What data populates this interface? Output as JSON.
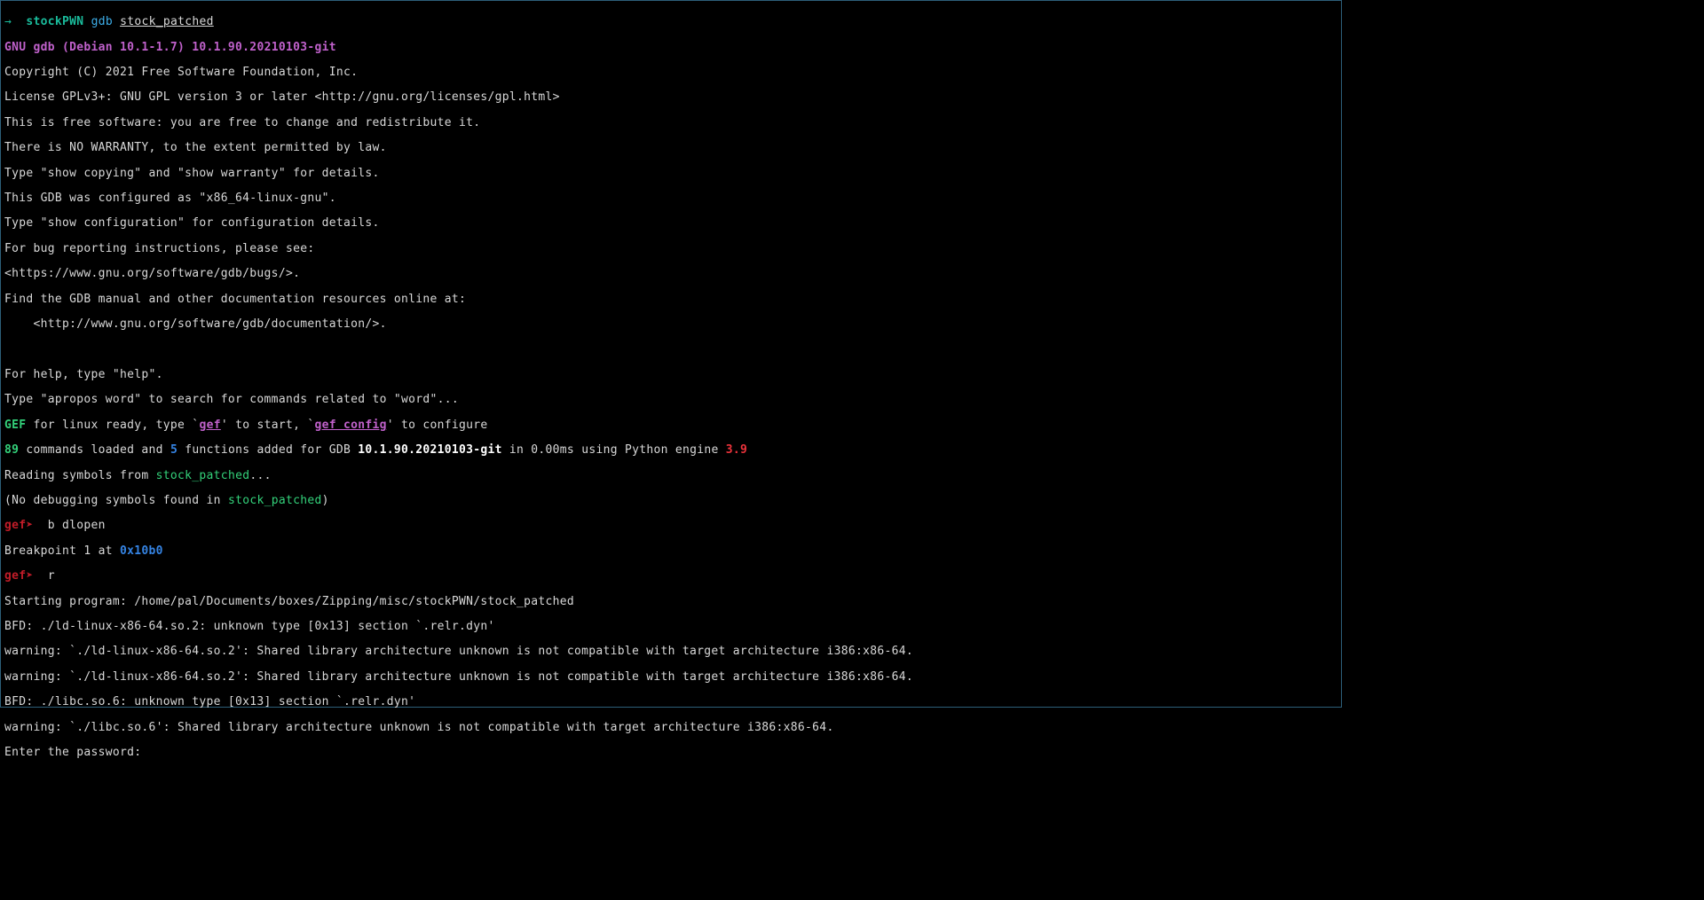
{
  "prompt_line": {
    "arrow": "→",
    "cwd": "stockPWN",
    "cmd": "gdb",
    "arg": "stock_patched"
  },
  "banner": {
    "l1_a": "GNU gdb (Debian 10.1-1.7)",
    "l1_b": " 10.1.90.20210103-git",
    "l2": "Copyright (C) 2021 Free Software Foundation, Inc.",
    "l3": "License GPLv3+: GNU GPL version 3 or later <http://gnu.org/licenses/gpl.html>",
    "l4": "This is free software: you are free to change and redistribute it.",
    "l5": "There is NO WARRANTY, to the extent permitted by law.",
    "l6": "Type \"show copying\" and \"show warranty\" for details.",
    "l7": "This GDB was configured as \"x86_64-linux-gnu\".",
    "l8": "Type \"show configuration\" for configuration details.",
    "l9": "For bug reporting instructions, please see:",
    "l10": "<https://www.gnu.org/software/gdb/bugs/>.",
    "l11": "Find the GDB manual and other documentation resources online at:",
    "l12": "    <http://www.gnu.org/software/gdb/documentation/>.",
    "l13": "",
    "l14": "For help, type \"help\".",
    "l15": "Type \"apropos word\" to search for commands related to \"word\"..."
  },
  "gef": {
    "label": "GEF",
    "mid1": " for linux ready, type `",
    "link1": "gef",
    "mid2": "' to start, `",
    "link2": "gef config",
    "mid3": "' to configure",
    "n_cmds": "89",
    "mid4": " commands loaded and ",
    "n_funcs": "5",
    "mid5": " functions added for GDB ",
    "gdbver": "10.1.90.20210103-git",
    "mid6": " in 0.00ms using Python engine ",
    "pyver": "3.9"
  },
  "symbols": {
    "read_a": "Reading symbols from ",
    "read_b": "stock_patched",
    "read_c": "...",
    "nodebug_a": "(No debugging symbols found in ",
    "nodebug_b": "stock_patched",
    "nodebug_c": ")"
  },
  "session": {
    "prompt": "gef➤",
    "cmd1": "  b dlopen",
    "bp_a": "Breakpoint 1 at ",
    "bp_b": "0x10b0",
    "cmd2": "  r",
    "start": "Starting program: /home/pal/Documents/boxes/Zipping/misc/stockPWN/stock_patched",
    "bfd1": "BFD: ./ld-linux-x86-64.so.2: unknown type [0x13] section `.relr.dyn'",
    "warn1": "warning: `./ld-linux-x86-64.so.2': Shared library architecture unknown is not compatible with target architecture i386:x86-64.",
    "warn2": "warning: `./ld-linux-x86-64.so.2': Shared library architecture unknown is not compatible with target architecture i386:x86-64.",
    "bfd2": "BFD: ./libc.so.6: unknown type [0x13] section `.relr.dyn'",
    "warn3": "warning: `./libc.so.6': Shared library architecture unknown is not compatible with target architecture i386:x86-64.",
    "pwprompt": "Enter the password: "
  }
}
